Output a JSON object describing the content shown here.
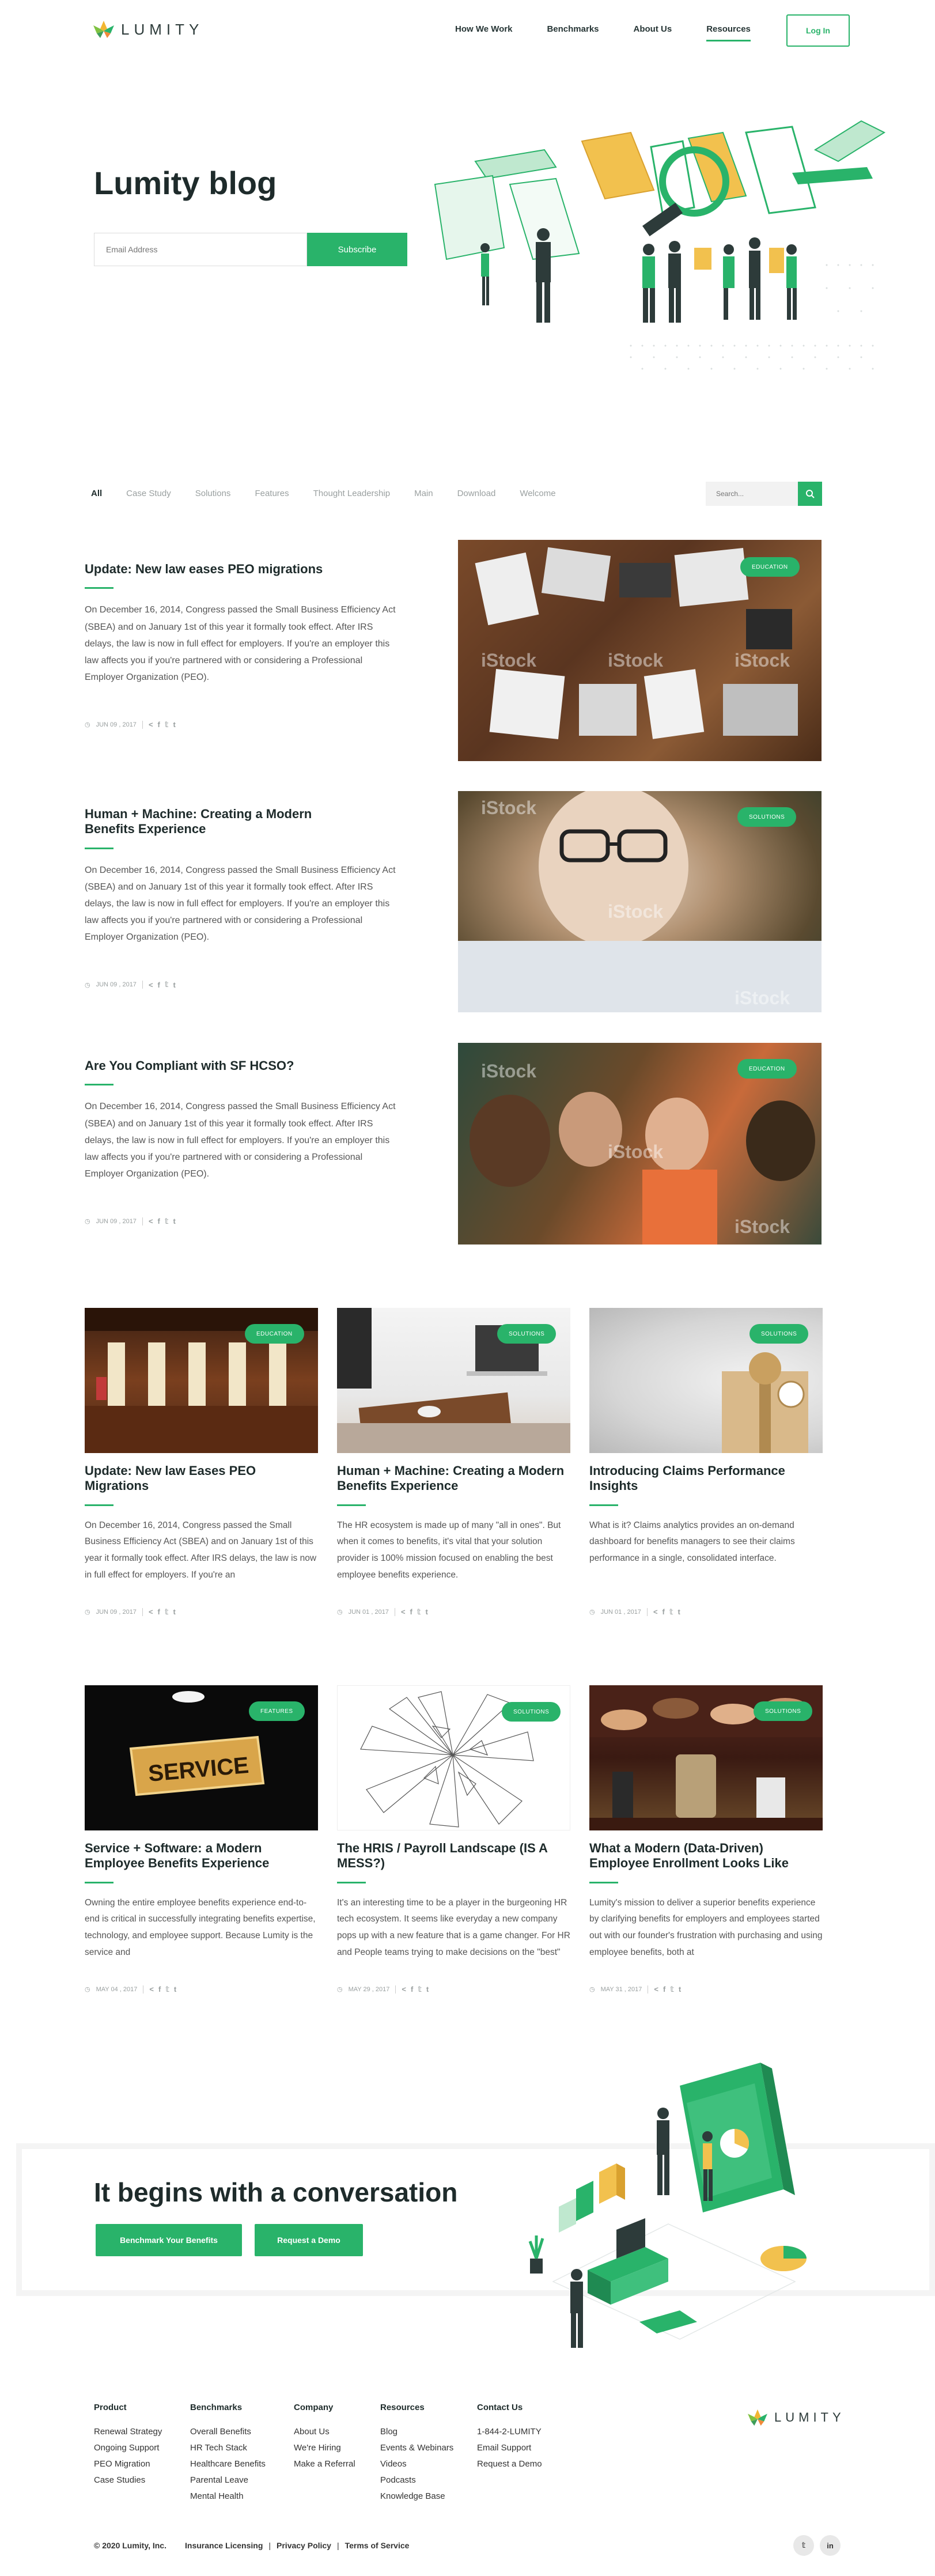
{
  "header": {
    "brand": "LUMITY",
    "nav": [
      "How We Work",
      "Benchmarks",
      "About Us",
      "Resources"
    ],
    "login": "Log In"
  },
  "hero": {
    "title": "Lumity blog",
    "email_placeholder": "Email Address",
    "subscribe": "Subscribe"
  },
  "filters": {
    "items": [
      "All",
      "Case Study",
      "Solutions",
      "Features",
      "Thought Leadership",
      "Main",
      "Download",
      "Welcome"
    ],
    "search_placeholder": "Search..."
  },
  "featured": [
    {
      "title": "Update: New law eases PEO migrations",
      "body": "On December 16, 2014, Congress passed the Small Business Efficiency Act (SBEA) and on January 1st of this year it formally took effect. After IRS delays, the law is now in full effect for employers. If you're an employer this law affects you if you're partnered with or considering a Professional Employer Organization (PEO).",
      "date": "JUN 09 , 2017",
      "tag": "EDUCATION"
    },
    {
      "title": "Human + Machine: Creating a Modern Benefits Experience",
      "body": "On December 16, 2014, Congress passed the Small Business Efficiency Act (SBEA) and on January 1st of this year it formally took effect. After IRS delays, the law is now in full effect for employers. If you're an employer this law affects you if you're partnered with or considering a Professional Employer Organization (PEO).",
      "date": "JUN 09 , 2017",
      "tag": "SOLUTIONS"
    },
    {
      "title": "Are You Compliant  with SF HCSO?",
      "body": "On December 16, 2014, Congress passed the Small Business Efficiency Act (SBEA) and on January 1st of this year it formally took effect. After IRS delays, the law is now in full effect for employers. If you're an employer this law affects you if you're partnered with or considering a Professional Employer Organization (PEO).",
      "date": "JUN 09 , 2017",
      "tag": "EDUCATION"
    }
  ],
  "cards": [
    {
      "title": "Update: New law Eases PEO Migrations",
      "body": "On December 16, 2014, Congress passed the Small Business Efficiency Act (SBEA) and on January 1st of this year it formally took effect. After IRS delays, the law is now in full effect for employers. If you're an",
      "date": "JUN 09 , 2017",
      "tag": "EDUCATION"
    },
    {
      "title": "Human + Machine: Creating a Modern Benefits Experience",
      "body": "The HR ecosystem is made up of many \"all in ones\". But when it comes to benefits, it's vital that your solution provider is 100% mission focused on enabling the best employee benefits experience.",
      "date": "JUN 01 , 2017",
      "tag": "SOLUTIONS"
    },
    {
      "title": "Introducing Claims Performance Insights",
      "body": "What is it? Claims analytics provides an on-demand dashboard for benefits managers to see their claims performance in a single, consolidated interface.",
      "date": "JUN 01 , 2017",
      "tag": "SOLUTIONS"
    },
    {
      "title": "Service + Software: a Modern Employee Benefits Experience",
      "body": "Owning the entire employee benefits experience end-to-end is critical in successfully integrating benefits expertise, technology, and employee support. Because Lumity is the service and",
      "date": "MAY 04 , 2017",
      "tag": "FEATURES"
    },
    {
      "title": "The HRIS / Payroll Landscape (IS A MESS?)",
      "body": "It's an interesting time to be a player in the burgeoning HR tech ecosystem. It seems like everyday a new company pops up with a new feature that is a game changer. For HR and People teams trying to make decisions on the \"best\" vendor for",
      "date": "MAY 29 , 2017",
      "tag": "SOLUTIONS"
    },
    {
      "title": "What a Modern (Data-Driven) Employee Enrollment Looks Like",
      "body": "Lumity's mission to deliver a superior benefits experience by clarifying benefits for employers and employees started out with our founder's frustration with purchasing and using employee benefits, both at",
      "date": "MAY 31 , 2017",
      "tag": "SOLUTIONS"
    }
  ],
  "cta": {
    "title": "It begins with a conversation",
    "btn1": "Benchmark Your Benefits",
    "btn2": "Request a Demo"
  },
  "footer": {
    "columns": [
      {
        "heading": "Product",
        "links": [
          "Renewal Strategy",
          "Ongoing Support",
          "PEO Migration",
          "Case Studies"
        ]
      },
      {
        "heading": "Benchmarks",
        "links": [
          "Overall Benefits",
          "HR Tech Stack",
          "Healthcare Benefits",
          "Parental Leave",
          "Mental Health"
        ]
      },
      {
        "heading": "Company",
        "links": [
          "About Us",
          "We're Hiring",
          "Make a Referral"
        ]
      },
      {
        "heading": "Resources",
        "links": [
          "Blog",
          "Events & Webinars",
          "Videos",
          "Podcasts",
          "Knowledge Base"
        ]
      },
      {
        "heading": "Contact Us",
        "links": [
          "1-844-2-LUMITY",
          "Email Support",
          "Request a Demo"
        ]
      }
    ],
    "brand": "LUMITY",
    "copyright": "© 2020 Lumity, Inc.",
    "legal": [
      "Insurance Licensing",
      "Privacy Policy",
      "Terms of Service"
    ],
    "social": [
      "twitter-icon",
      "linkedin-icon"
    ],
    "social_glyphs": [
      "𝕥",
      "in"
    ]
  },
  "watermark": "iStock",
  "colors": {
    "accent": "#29b36a",
    "dark": "#1e2b2b"
  }
}
